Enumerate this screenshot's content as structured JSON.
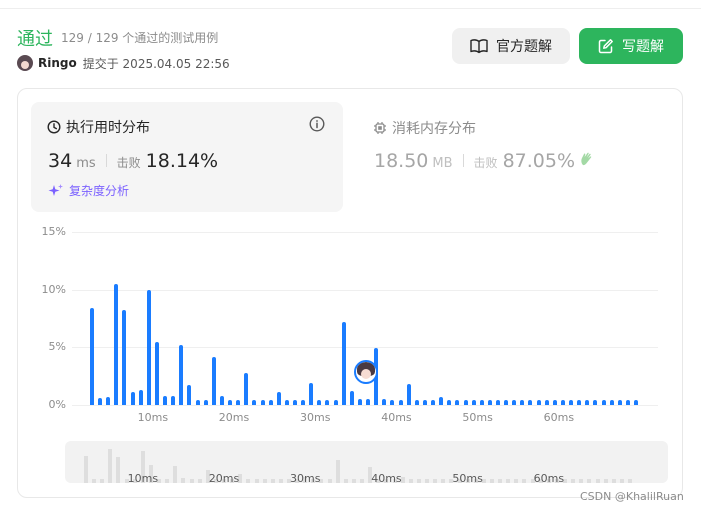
{
  "header": {
    "status": "通过",
    "cases_text": "129 / 129 个通过的测试用例",
    "author": "Ringo",
    "submitted_text": "提交于 2025.04.05 22:56",
    "official_btn": "官方题解",
    "write_btn": "写题解"
  },
  "runtime": {
    "title": "执行用时分布",
    "value": "34",
    "unit": "ms",
    "beat_label": "击败",
    "beat_value": "18.14%",
    "complexity": "复杂度分析"
  },
  "memory": {
    "title": "消耗内存分布",
    "value": "18.50",
    "unit": "MB",
    "beat_label": "击败",
    "beat_value": "87.05%"
  },
  "colors": {
    "accent_green": "#2db55d",
    "bar_blue": "#1a7cff",
    "complexity_purple": "#7b61ff"
  },
  "watermark": "CSDN @KhalilRuan",
  "chart_data": {
    "type": "bar",
    "title": "",
    "xlabel": "",
    "ylabel": "",
    "y_tick_labels": [
      "15%",
      "10%",
      "5%",
      "0%"
    ],
    "x_tick_labels": [
      "10ms",
      "20ms",
      "30ms",
      "40ms",
      "50ms",
      "60ms"
    ],
    "ylim": [
      0,
      15
    ],
    "grid": true,
    "highlight_x": 34,
    "x": [
      3,
      4,
      5,
      6,
      7,
      8,
      9,
      10,
      11,
      12,
      13,
      14,
      15,
      16,
      17,
      18,
      19,
      20,
      21,
      22,
      23,
      24,
      25,
      26,
      27,
      28,
      29,
      30,
      31,
      32,
      33,
      34,
      35,
      36,
      37,
      38,
      39,
      40,
      41,
      42,
      43,
      44,
      45,
      46,
      47,
      48,
      49,
      50,
      51,
      52,
      53,
      54,
      55,
      56,
      57,
      58,
      59,
      60,
      61,
      62,
      63,
      64,
      65,
      66,
      67,
      68,
      69,
      70
    ],
    "values": [
      8.4,
      0.6,
      0.7,
      10.5,
      8.2,
      1.1,
      1.3,
      10.0,
      5.5,
      0.8,
      0.8,
      5.2,
      1.7,
      0.4,
      0.4,
      4.2,
      0.8,
      0.4,
      0.4,
      2.8,
      0.4,
      0.4,
      0.4,
      1.1,
      0.4,
      0.4,
      0.4,
      1.9,
      0.4,
      0.4,
      0.4,
      7.2,
      1.2,
      0.5,
      0.5,
      4.9,
      0.5,
      0.4,
      0.4,
      1.8,
      0.4,
      0.4,
      0.4,
      0.7,
      0.4,
      0.4,
      0.4,
      0.4,
      0.4,
      0.4,
      0.4,
      0.4,
      0.4,
      0.4,
      0.4,
      0.4,
      0.4,
      0.4,
      0.4,
      0.4,
      0.4,
      0.4,
      0.4,
      0.4,
      0.4,
      0.4,
      0.4,
      0.4
    ]
  }
}
